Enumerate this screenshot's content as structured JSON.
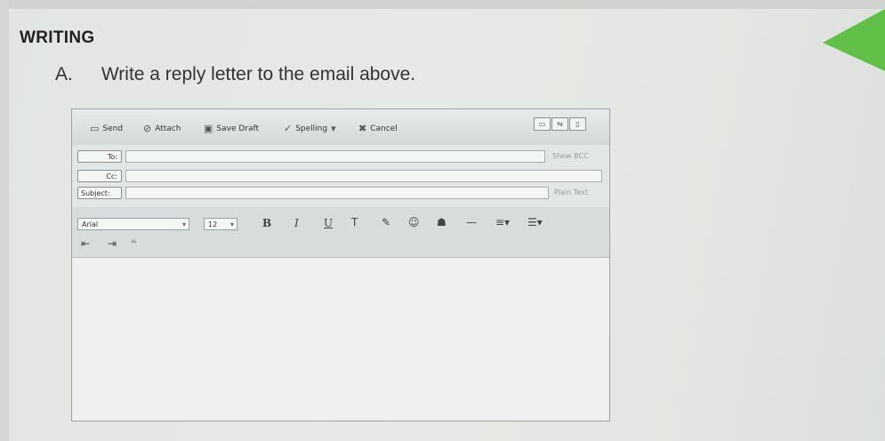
{
  "section_title": "WRITING",
  "task": {
    "label": "A.",
    "text": "Write a reply letter to the email above."
  },
  "email": {
    "toolbar": {
      "send": "Send",
      "attach": "Attach",
      "save_draft": "Save Draft",
      "spelling": "Spelling",
      "cancel": "Cancel"
    },
    "fields": {
      "to": "To:",
      "cc": "Cc:",
      "subject": "Subject:"
    },
    "show_bcc": "Show BCC",
    "plain_text": "Plain Text",
    "format": {
      "font": "Arial",
      "size": "12"
    },
    "icons": [
      "send-icon",
      "attach-icon",
      "save-icon",
      "spelling-icon",
      "cancel-icon",
      "bold-icon",
      "italic-icon",
      "underline-icon",
      "text-color-icon",
      "highlight-icon",
      "emoticon-icon",
      "image-icon",
      "horizontal-rule-icon",
      "align-icon",
      "list-icon",
      "outdent-icon",
      "indent-icon",
      "blockquote-icon"
    ],
    "colors": {
      "accent_green": "#5fbf47"
    }
  }
}
